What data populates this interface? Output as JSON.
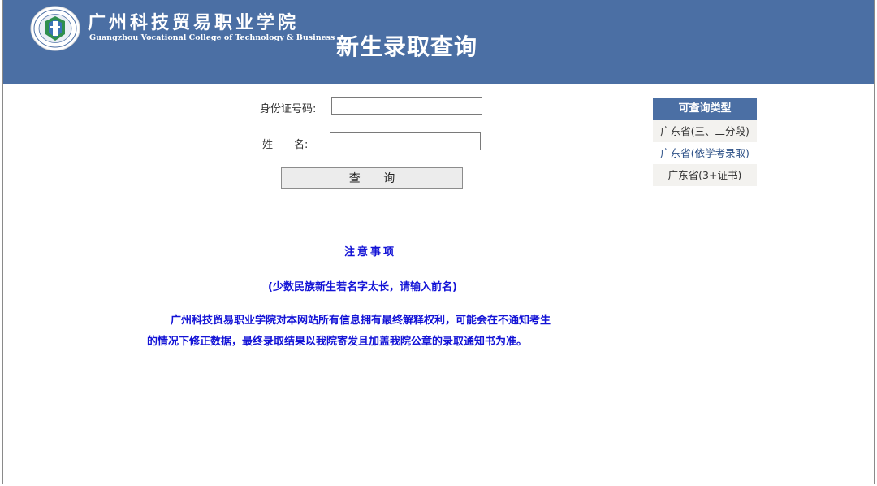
{
  "header": {
    "school_name_cn": "广州科技贸易职业学院",
    "school_name_en": "Guangzhou Vocational College of Technology & Business",
    "page_title": "新生录取查询",
    "logo_icon": "college-emblem-icon",
    "background_color": "#4b6fa4"
  },
  "form": {
    "id_label": "身份证号码:",
    "id_value": "",
    "name_label": "姓　　名:",
    "name_value": "",
    "submit_label": "查 询"
  },
  "side_panel": {
    "title": "可查询类型",
    "items": [
      {
        "label": "广东省(三、二分段)"
      },
      {
        "label": "广东省(依学考录取)"
      },
      {
        "label": "广东省(3+证书)"
      }
    ]
  },
  "notes": {
    "title": "注意事项",
    "subtitle": "(少数民族新生若名字太长，请输入前名)",
    "paragraph_line1": "广州科技贸易职业学院对本网站所有信息拥有最终解释权利，可能会在不通知考生",
    "paragraph_line2": "的情况下修正数据，最终录取结果以我院寄发且加盖我院公章的录取通知书为准。",
    "text_color": "#1313d6"
  }
}
